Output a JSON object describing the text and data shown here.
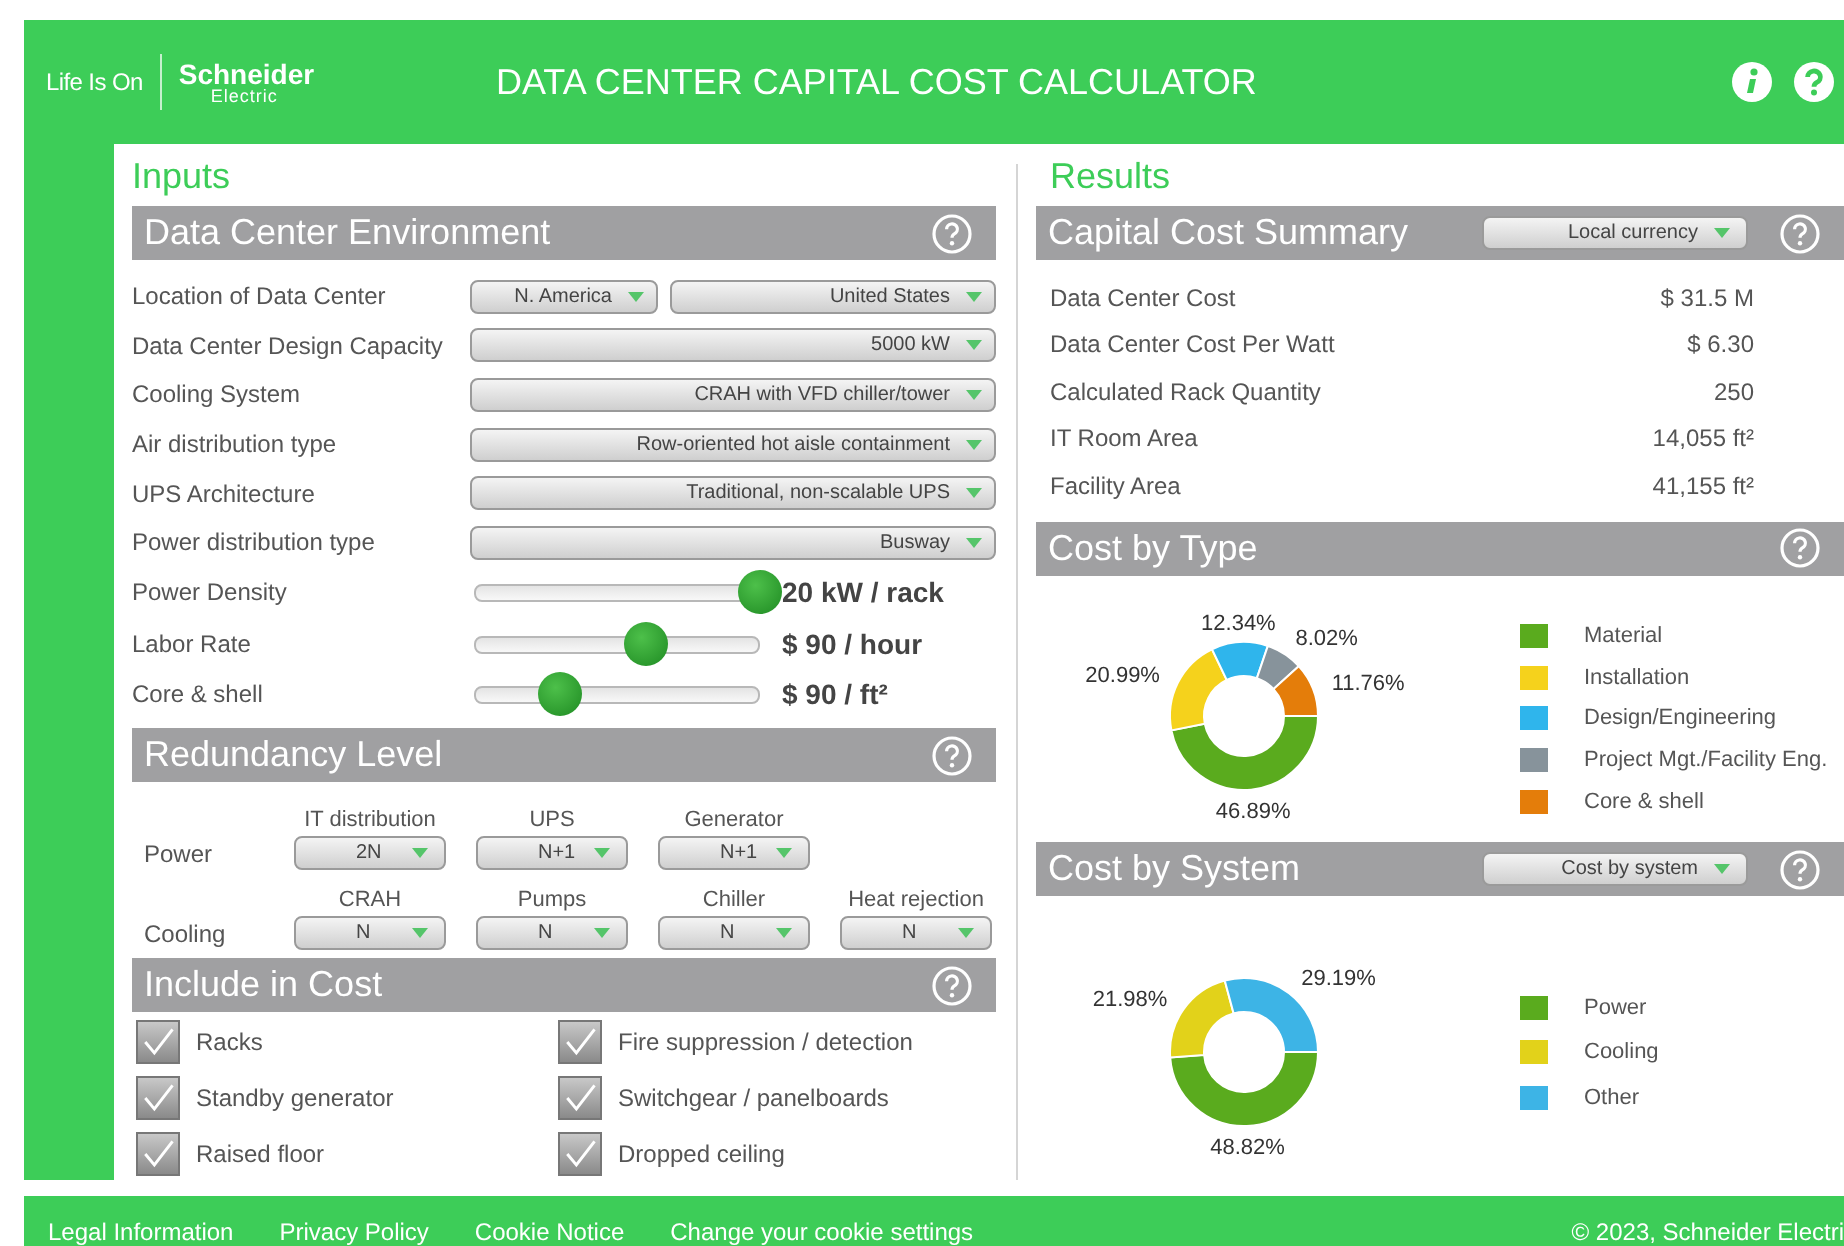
{
  "header": {
    "tagline": "Life Is On",
    "brand": "Schneider",
    "brand_sub": "Electric",
    "title": "DATA CENTER CAPITAL COST CALCULATOR"
  },
  "inputs": {
    "title": "Inputs",
    "environment": {
      "title": "Data Center Environment",
      "rows": [
        {
          "label": "Location of Data Center",
          "kind": "select",
          "options": [
            "N. America",
            "United States"
          ]
        },
        {
          "label": "Data Center Design Capacity",
          "kind": "select",
          "options": [
            "5000 kW"
          ]
        },
        {
          "label": "Cooling System",
          "kind": "select",
          "options": [
            "CRAH with VFD chiller/tower"
          ]
        },
        {
          "label": "Air distribution type",
          "kind": "select",
          "options": [
            "Row-oriented hot aisle containment"
          ]
        },
        {
          "label": "UPS Architecture",
          "kind": "select",
          "options": [
            "Traditional, non-scalable UPS"
          ]
        },
        {
          "label": "Power distribution type",
          "kind": "select",
          "options": [
            "Busway"
          ]
        },
        {
          "label": "Power Density",
          "kind": "slider",
          "level": 1.0,
          "reading": "20 kW / rack"
        },
        {
          "label": "Labor Rate",
          "kind": "slider",
          "level": 0.6,
          "reading": "$ 90 / hour"
        },
        {
          "label": "Core & shell",
          "kind": "slider",
          "level": 0.3,
          "reading": "$ 90 / ft²"
        }
      ]
    },
    "redundancy": {
      "title": "Redundancy Level",
      "groups": [
        {
          "label": "Power",
          "items": [
            {
              "label": "IT distribution",
              "value": "2N"
            },
            {
              "label": "UPS",
              "value": "N+1"
            },
            {
              "label": "Generator",
              "value": "N+1"
            }
          ]
        },
        {
          "label": "Cooling",
          "items": [
            {
              "label": "CRAH",
              "value": "N"
            },
            {
              "label": "Pumps",
              "value": "N"
            },
            {
              "label": "Chiller",
              "value": "N"
            },
            {
              "label": "Heat rejection",
              "value": "N"
            }
          ]
        }
      ]
    },
    "include": {
      "title": "Include in Cost",
      "items": [
        {
          "label": "Racks",
          "checked": true
        },
        {
          "label": "Fire suppression / detection",
          "checked": true
        },
        {
          "label": "Standby generator",
          "checked": true
        },
        {
          "label": "Switchgear / panelboards",
          "checked": true
        },
        {
          "label": "Raised floor",
          "checked": true
        },
        {
          "label": "Dropped ceiling",
          "checked": true
        }
      ]
    }
  },
  "results": {
    "title": "Results",
    "summary": {
      "title": "Capital Cost Summary",
      "dropdown": "Local currency",
      "rows": [
        {
          "label": "Data Center Cost",
          "value": "$ 31.5 M"
        },
        {
          "label": "Data Center Cost Per Watt",
          "value": "$ 6.30"
        },
        {
          "label": "Calculated Rack Quantity",
          "value": "250"
        },
        {
          "label": "IT Room Area",
          "value": "14,055 ft²"
        },
        {
          "label": "Facility Area",
          "value": "41,155 ft²"
        }
      ]
    },
    "cost_by_type": {
      "title": "Cost by Type",
      "chart_data": {
        "type": "donut",
        "categories": [
          "Material",
          "Installation",
          "Design/Engineering",
          "Project Mgt./Facility Eng.",
          "Core & shell"
        ],
        "values": [
          46.89,
          20.99,
          12.34,
          8.02,
          11.76
        ],
        "value_labels": [
          "46.89%",
          "20.99%",
          "12.34%",
          "8.02%",
          "11.76%"
        ]
      },
      "legend": [
        {
          "color": "#5aab1e"
        },
        {
          "color": "#f5d21c"
        },
        {
          "color": "#2fb5ec"
        },
        {
          "color": "#87939b"
        },
        {
          "color": "#e47d0a"
        }
      ]
    },
    "cost_by_system": {
      "title": "Cost by System",
      "dropdown": "Cost by system",
      "chart_data": {
        "type": "donut",
        "categories": [
          "Power",
          "Cooling",
          "Other"
        ],
        "values": [
          48.82,
          21.98,
          29.19
        ],
        "value_labels": [
          "48.82%",
          "21.98%",
          "29.19%"
        ]
      },
      "legend": [
        {
          "color": "#5aab1e"
        },
        {
          "color": "#e2d21a"
        },
        {
          "color": "#3db4e6"
        }
      ]
    }
  },
  "footer": {
    "links": [
      "Legal Information",
      "Privacy Policy",
      "Cookie Notice",
      "Change your cookie settings"
    ],
    "copyright": "© 2023, Schneider Electri"
  }
}
